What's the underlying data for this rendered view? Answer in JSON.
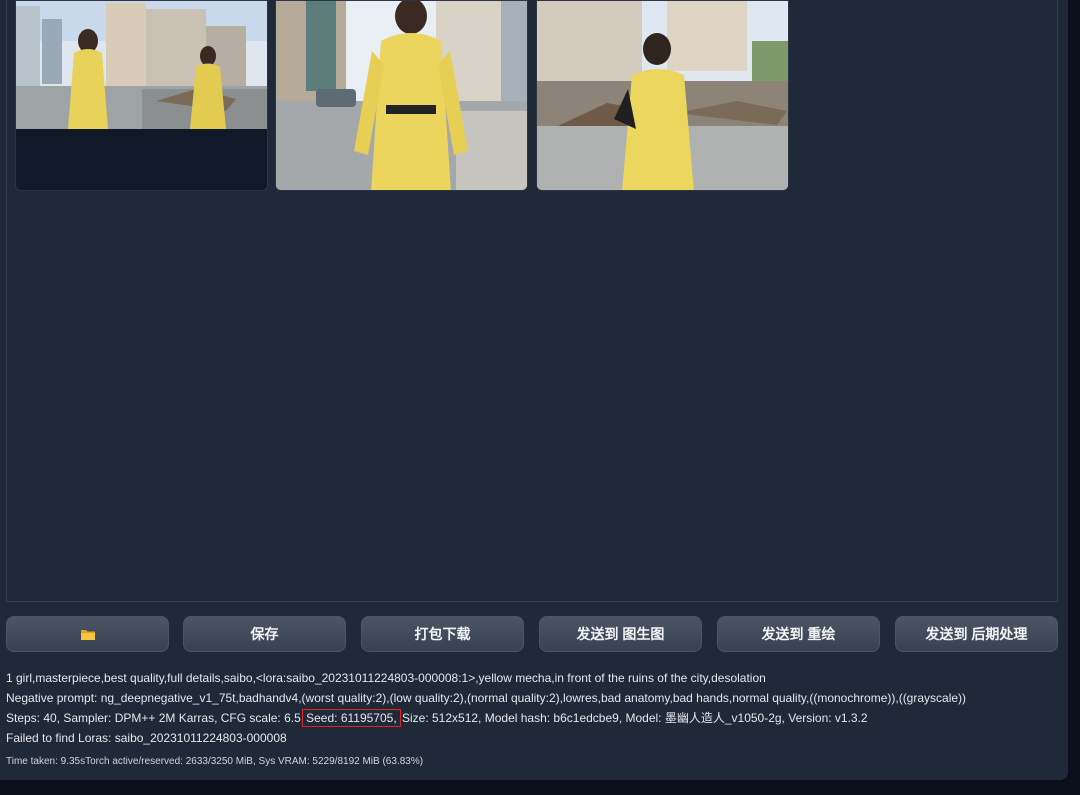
{
  "buttons": {
    "open_folder_icon": "folder-icon",
    "save": "保存",
    "zip_download": "打包下载",
    "send_to_img2img": "发送到 图生图",
    "send_to_inpaint": "发送到 重绘",
    "send_to_extras": "发送到 后期处理"
  },
  "generation_info": {
    "prompt": "1 girl,masterpiece,best quality,full details,saibo,<lora:saibo_20231011224803-000008:1>,yellow mecha,in front of the ruins of the city,desolation",
    "negative_prompt": "Negative prompt: ng_deepnegative_v1_75t,badhandv4,(worst quality:2),(low quality:2),(normal quality:2),lowres,bad anatomy,bad hands,normal quality,((monochrome)),((grayscale))",
    "params_before_seed": "Steps: 40, Sampler: DPM++ 2M Karras, CFG scale: 6.5",
    "seed": "Seed: 61195705,",
    "params_after_seed": "Size: 512x512, Model hash: b6c1edcbe9, Model: 墨幽人造人_v1050-2g, Version: v1.3.2",
    "lora_warning": "Failed to find Loras: saibo_20231011224803-000008",
    "timing": "Time taken: 9.35sTorch active/reserved: 2633/3250 MiB, Sys VRAM: 5229/8192 MiB (63.83%)"
  },
  "colors": {
    "accent_highlight": "#dc2626",
    "panel_bg": "#1f2937",
    "button_bg": "#4b5563"
  }
}
